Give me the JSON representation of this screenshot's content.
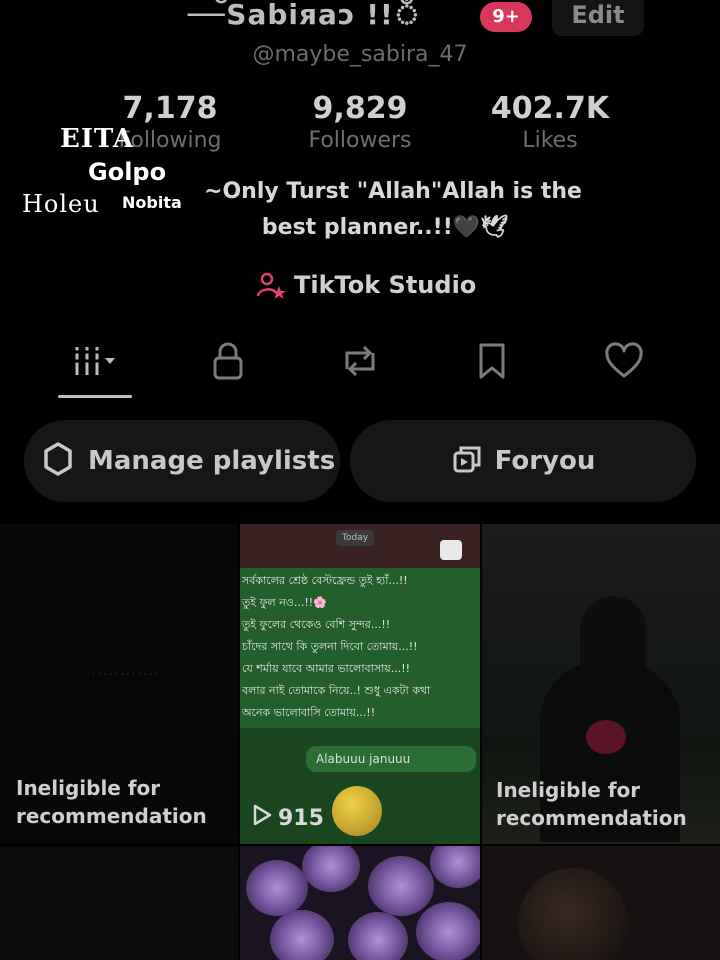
{
  "profile": {
    "display_name": "—ঁSabiяaↄ !!ঁ",
    "notification_count": "9+",
    "edit_label": "Edit",
    "username": "@maybe_sabira_47",
    "bio_line1": "~Only Turst \"Allah\"Allah is the",
    "bio_line2": "best planner..!!🖤🕊"
  },
  "stats": [
    {
      "value": "7,178",
      "label": "Following"
    },
    {
      "value": "9,829",
      "label": "Followers"
    },
    {
      "value": "402.7K",
      "label": "Likes"
    }
  ],
  "watermark": {
    "line1": "EITA",
    "line2": "Golpo",
    "line3": "Holeu",
    "line4": "Nobita"
  },
  "studio": {
    "label": "TikTok Studio"
  },
  "tabs": [
    {
      "name": "videos",
      "icon": "grid-icon",
      "selected": true
    },
    {
      "name": "private",
      "icon": "lock-icon"
    },
    {
      "name": "reposts",
      "icon": "repost-icon"
    },
    {
      "name": "favorites",
      "icon": "bookmark-icon"
    },
    {
      "name": "liked",
      "icon": "heart-icon"
    }
  ],
  "actions": {
    "playlists_label": "Manage playlists",
    "foryou_label": "Foryou"
  },
  "grid": {
    "ineligible_label_line1": "Ineligible for",
    "ineligible_label_line2": "recommendation",
    "chat_today": "Today",
    "chat_lines": [
      "সর্বকালের শ্রেষ্ঠ বেস্টফ্রেন্ড তুই হ্যাঁ...!!",
      "তুই ফুল নও...!!🌸",
      "তুই ফুলের থেকেও বেশি সুন্দর...!!",
      "চাঁদের সাথে কি তুলনা দিবো তোমায়...!!",
      "যে শর্মায় যাবে আমার ভালোবাসায়...!!",
      "বলার নাই তোমাকে নিয়ে..! শুধু একটা কথা",
      "অনেক ভালোবাসি তোমায়...!!"
    ],
    "chat_reply": "Alabuuu januuu",
    "play_count": "915"
  },
  "colors": {
    "badge": "#d8365a",
    "studio_icon": "#e0446a",
    "chat_green": "#235f2b"
  }
}
